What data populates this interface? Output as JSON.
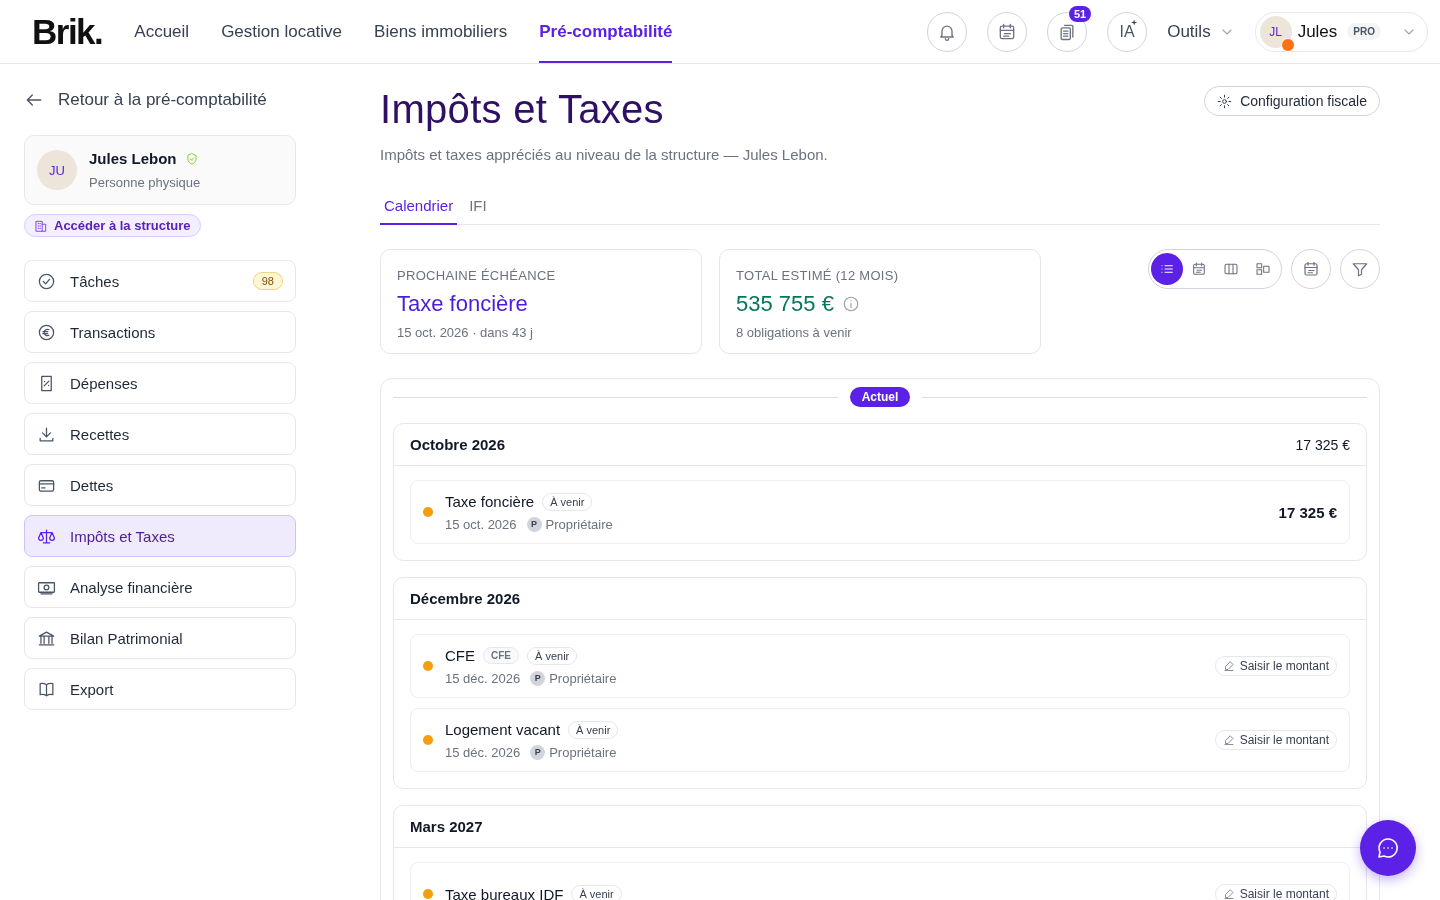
{
  "brand": "Brik.",
  "nav": [
    {
      "label": "Accueil",
      "selected": false
    },
    {
      "label": "Gestion locative",
      "selected": false
    },
    {
      "label": "Biens immobiliers",
      "selected": false
    },
    {
      "label": "Pré-comptabilité",
      "selected": true
    }
  ],
  "header_buttons": [
    {
      "kind": "bell"
    },
    {
      "kind": "calendar"
    },
    {
      "kind": "clipboard",
      "badge": "51"
    },
    {
      "kind": "ai",
      "label": "IA"
    }
  ],
  "tools_menu": "Outils",
  "user": {
    "initials": "JL",
    "name": "Jules",
    "plan": "PRO"
  },
  "back_link": "Retour à la pré-comptabilité",
  "profile": {
    "initials": "JU",
    "name": "Jules Lebon",
    "verified": true,
    "type": "Personne physique"
  },
  "structure_link": "Accéder à la structure",
  "sidebar_items": [
    {
      "label": "Tâches",
      "count": "98",
      "selected": false
    },
    {
      "label": "Transactions",
      "selected": false
    },
    {
      "label": "Dépenses",
      "selected": false
    },
    {
      "label": "Recettes",
      "selected": false
    },
    {
      "label": "Dettes",
      "selected": false
    },
    {
      "label": "Impôts et Taxes",
      "selected": true
    },
    {
      "label": "Analyse financière",
      "selected": false
    },
    {
      "label": "Bilan Patrimonial",
      "selected": false
    },
    {
      "label": "Export",
      "selected": false
    }
  ],
  "page": {
    "title": "Impôts et Taxes",
    "subtitle": "Impôts et taxes appréciés au niveau de la structure — Jules Lebon.",
    "config_button": "Configuration fiscale"
  },
  "tabs": [
    {
      "label": "Calendrier",
      "selected": true
    },
    {
      "label": "IFI",
      "selected": false
    }
  ],
  "summary_cards": [
    {
      "kind": "next",
      "label": "PROCHAINE ÉCHÉANCE",
      "value": "Taxe foncière",
      "detail": "15 oct. 2026 · dans 43 j"
    },
    {
      "kind": "total",
      "label": "TOTAL ESTIMÉ (12 MOIS)",
      "value": "535 755 €",
      "info": true,
      "detail": "8 obligations à venir"
    }
  ],
  "view_modes": [
    {
      "kind": "list",
      "selected": true
    },
    {
      "kind": "calendar",
      "selected": false
    },
    {
      "kind": "columns",
      "selected": false
    },
    {
      "kind": "blocks",
      "selected": false
    }
  ],
  "timeline_marker": "Actuel",
  "months": [
    {
      "title": "Octobre 2026",
      "total": "17 325 €",
      "events": [
        {
          "name": "Taxe foncière",
          "tags": [
            {
              "kind": "status",
              "label": "À venir"
            }
          ],
          "date": "15 oct. 2026",
          "owner_initial": "P",
          "owner": "Propriétaire",
          "amount": "17 325 €"
        }
      ]
    },
    {
      "title": "Décembre 2026",
      "events": [
        {
          "name": "CFE",
          "tags": [
            {
              "kind": "code",
              "label": "CFE"
            },
            {
              "kind": "status",
              "label": "À venir"
            }
          ],
          "date": "15 déc. 2026",
          "owner_initial": "P",
          "owner": "Propriétaire",
          "action": "Saisir le montant"
        },
        {
          "name": "Logement vacant",
          "tags": [
            {
              "kind": "status",
              "label": "À venir"
            }
          ],
          "date": "15 déc. 2026",
          "owner_initial": "P",
          "owner": "Propriétaire",
          "action": "Saisir le montant"
        }
      ]
    },
    {
      "title": "Mars 2027",
      "events": [
        {
          "name": "Taxe bureaux IDF",
          "tags": [
            {
              "kind": "status",
              "label": "À venir"
            }
          ],
          "action": "Saisir le montant"
        }
      ]
    }
  ]
}
